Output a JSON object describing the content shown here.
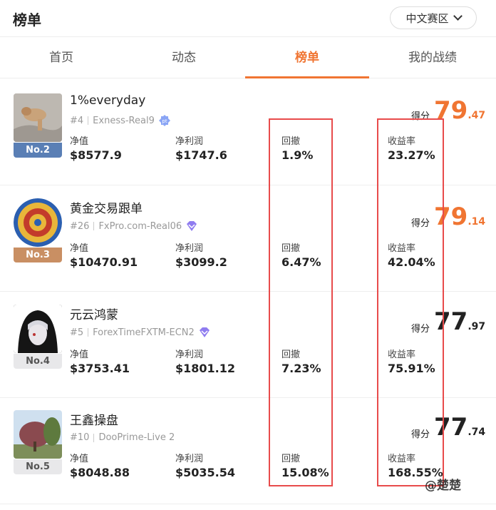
{
  "header": {
    "title": "榜单",
    "region": "中文赛区"
  },
  "tabs": [
    "首页",
    "动态",
    "榜单",
    "我的战绩"
  ],
  "labels": {
    "net_value": "净值",
    "net_profit": "净利润",
    "drawdown": "回撤",
    "return_rate": "收益率",
    "score": "得分"
  },
  "rows": [
    {
      "name": "1%everyday",
      "rank": "#4",
      "account": "Exness-Real9",
      "badge": "No.2",
      "net_value": "$8577.9",
      "net_profit": "$1747.6",
      "drawdown": "1.9%",
      "return_rate": "23.27%",
      "score_int": "79",
      "score_dec": ".47"
    },
    {
      "name": "黄金交易跟单",
      "rank": "#26",
      "account": "FxPro.com-Real06",
      "badge": "No.3",
      "net_value": "$10470.91",
      "net_profit": "$3099.2",
      "drawdown": "6.47%",
      "return_rate": "42.04%",
      "score_int": "79",
      "score_dec": ".14"
    },
    {
      "name": "元云鸿蒙",
      "rank": "#5",
      "account": "ForexTimeFXTM-ECN2",
      "badge": "No.4",
      "net_value": "$3753.41",
      "net_profit": "$1801.12",
      "drawdown": "7.23%",
      "return_rate": "75.91%",
      "score_int": "77",
      "score_dec": ".97"
    },
    {
      "name": "王鑫操盘",
      "rank": "#10",
      "account": "DooPrime-Live 2",
      "badge": "No.5",
      "net_value": "$8048.88",
      "net_profit": "$5035.54",
      "drawdown": "15.08%",
      "return_rate": "168.55%",
      "score_int": "77",
      "score_dec": ".74"
    }
  ],
  "watermark": "@楚楚",
  "colors": {
    "accent": "#f07532",
    "highlight": "#e84b4b",
    "badge2": "#5a7fb5",
    "badge3": "#c98f63",
    "badge_gray": "#e8e8ea"
  },
  "icons": {
    "account_badge_row1": "pt-badge-icon",
    "account_badge_other": "verified-diamond-icon"
  }
}
